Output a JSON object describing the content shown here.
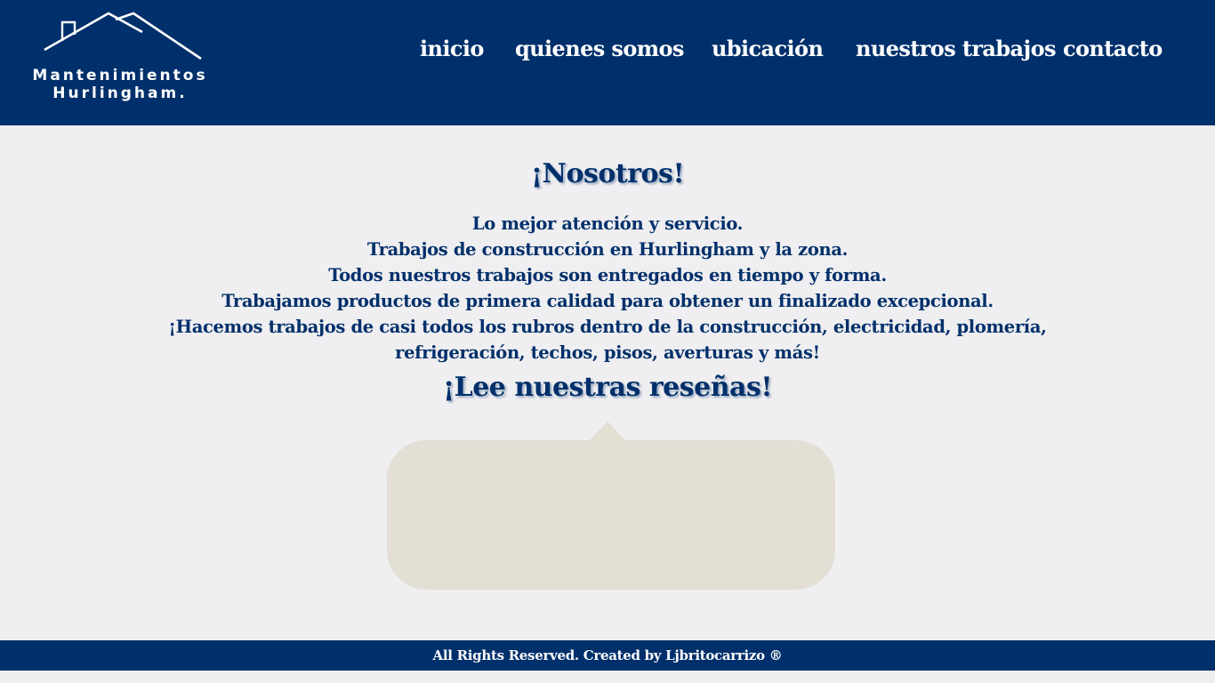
{
  "brand": {
    "line1": "Mantenimientos",
    "line2": "Hurlingham."
  },
  "nav": {
    "items": [
      {
        "label": "inicio"
      },
      {
        "label": "quienes somos"
      },
      {
        "label": "ubicación"
      },
      {
        "label": "nuestros trabajos"
      },
      {
        "label": "contacto"
      }
    ]
  },
  "about": {
    "title": "¡Nosotros!",
    "lines": [
      "Lo mejor atención y servicio.",
      "Trabajos de construcción en Hurlingham y la zona.",
      "Todos nuestros trabajos son entregados en tiempo y forma.",
      "Trabajamos productos de primera calidad para obtener un finalizado excepcional.",
      "¡Hacemos trabajos de casi todos los rubros dentro de la construcción, electricidad, plomería, refrigeración, techos, pisos, averturas y más!"
    ]
  },
  "reviews": {
    "title": "¡Lee nuestras reseñas!"
  },
  "footer": {
    "text": "All Rights Reserved. Created by Ljbritocarrizo ®"
  },
  "colors": {
    "primary": "#00306b",
    "background": "#efeef0",
    "review_box": "#e3dfd5",
    "text_light": "#ffffff"
  },
  "icons": {
    "logo": "house-roof-icon"
  }
}
